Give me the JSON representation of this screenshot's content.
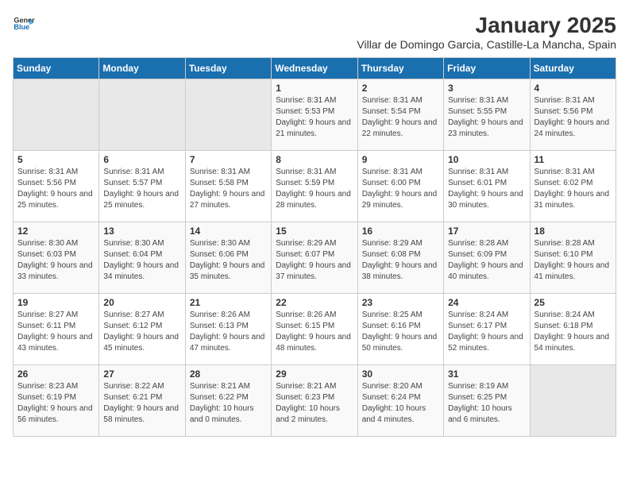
{
  "header": {
    "logo_line1": "General",
    "logo_line2": "Blue",
    "title": "January 2025",
    "subtitle": "Villar de Domingo Garcia, Castille-La Mancha, Spain"
  },
  "weekdays": [
    "Sunday",
    "Monday",
    "Tuesday",
    "Wednesday",
    "Thursday",
    "Friday",
    "Saturday"
  ],
  "weeks": [
    [
      {
        "day": "",
        "empty": true
      },
      {
        "day": "",
        "empty": true
      },
      {
        "day": "",
        "empty": true
      },
      {
        "day": "1",
        "sunrise": "Sunrise: 8:31 AM",
        "sunset": "Sunset: 5:53 PM",
        "daylight": "Daylight: 9 hours and 21 minutes."
      },
      {
        "day": "2",
        "sunrise": "Sunrise: 8:31 AM",
        "sunset": "Sunset: 5:54 PM",
        "daylight": "Daylight: 9 hours and 22 minutes."
      },
      {
        "day": "3",
        "sunrise": "Sunrise: 8:31 AM",
        "sunset": "Sunset: 5:55 PM",
        "daylight": "Daylight: 9 hours and 23 minutes."
      },
      {
        "day": "4",
        "sunrise": "Sunrise: 8:31 AM",
        "sunset": "Sunset: 5:56 PM",
        "daylight": "Daylight: 9 hours and 24 minutes."
      }
    ],
    [
      {
        "day": "5",
        "sunrise": "Sunrise: 8:31 AM",
        "sunset": "Sunset: 5:56 PM",
        "daylight": "Daylight: 9 hours and 25 minutes."
      },
      {
        "day": "6",
        "sunrise": "Sunrise: 8:31 AM",
        "sunset": "Sunset: 5:57 PM",
        "daylight": "Daylight: 9 hours and 25 minutes."
      },
      {
        "day": "7",
        "sunrise": "Sunrise: 8:31 AM",
        "sunset": "Sunset: 5:58 PM",
        "daylight": "Daylight: 9 hours and 27 minutes."
      },
      {
        "day": "8",
        "sunrise": "Sunrise: 8:31 AM",
        "sunset": "Sunset: 5:59 PM",
        "daylight": "Daylight: 9 hours and 28 minutes."
      },
      {
        "day": "9",
        "sunrise": "Sunrise: 8:31 AM",
        "sunset": "Sunset: 6:00 PM",
        "daylight": "Daylight: 9 hours and 29 minutes."
      },
      {
        "day": "10",
        "sunrise": "Sunrise: 8:31 AM",
        "sunset": "Sunset: 6:01 PM",
        "daylight": "Daylight: 9 hours and 30 minutes."
      },
      {
        "day": "11",
        "sunrise": "Sunrise: 8:31 AM",
        "sunset": "Sunset: 6:02 PM",
        "daylight": "Daylight: 9 hours and 31 minutes."
      }
    ],
    [
      {
        "day": "12",
        "sunrise": "Sunrise: 8:30 AM",
        "sunset": "Sunset: 6:03 PM",
        "daylight": "Daylight: 9 hours and 33 minutes."
      },
      {
        "day": "13",
        "sunrise": "Sunrise: 8:30 AM",
        "sunset": "Sunset: 6:04 PM",
        "daylight": "Daylight: 9 hours and 34 minutes."
      },
      {
        "day": "14",
        "sunrise": "Sunrise: 8:30 AM",
        "sunset": "Sunset: 6:06 PM",
        "daylight": "Daylight: 9 hours and 35 minutes."
      },
      {
        "day": "15",
        "sunrise": "Sunrise: 8:29 AM",
        "sunset": "Sunset: 6:07 PM",
        "daylight": "Daylight: 9 hours and 37 minutes."
      },
      {
        "day": "16",
        "sunrise": "Sunrise: 8:29 AM",
        "sunset": "Sunset: 6:08 PM",
        "daylight": "Daylight: 9 hours and 38 minutes."
      },
      {
        "day": "17",
        "sunrise": "Sunrise: 8:28 AM",
        "sunset": "Sunset: 6:09 PM",
        "daylight": "Daylight: 9 hours and 40 minutes."
      },
      {
        "day": "18",
        "sunrise": "Sunrise: 8:28 AM",
        "sunset": "Sunset: 6:10 PM",
        "daylight": "Daylight: 9 hours and 41 minutes."
      }
    ],
    [
      {
        "day": "19",
        "sunrise": "Sunrise: 8:27 AM",
        "sunset": "Sunset: 6:11 PM",
        "daylight": "Daylight: 9 hours and 43 minutes."
      },
      {
        "day": "20",
        "sunrise": "Sunrise: 8:27 AM",
        "sunset": "Sunset: 6:12 PM",
        "daylight": "Daylight: 9 hours and 45 minutes."
      },
      {
        "day": "21",
        "sunrise": "Sunrise: 8:26 AM",
        "sunset": "Sunset: 6:13 PM",
        "daylight": "Daylight: 9 hours and 47 minutes."
      },
      {
        "day": "22",
        "sunrise": "Sunrise: 8:26 AM",
        "sunset": "Sunset: 6:15 PM",
        "daylight": "Daylight: 9 hours and 48 minutes."
      },
      {
        "day": "23",
        "sunrise": "Sunrise: 8:25 AM",
        "sunset": "Sunset: 6:16 PM",
        "daylight": "Daylight: 9 hours and 50 minutes."
      },
      {
        "day": "24",
        "sunrise": "Sunrise: 8:24 AM",
        "sunset": "Sunset: 6:17 PM",
        "daylight": "Daylight: 9 hours and 52 minutes."
      },
      {
        "day": "25",
        "sunrise": "Sunrise: 8:24 AM",
        "sunset": "Sunset: 6:18 PM",
        "daylight": "Daylight: 9 hours and 54 minutes."
      }
    ],
    [
      {
        "day": "26",
        "sunrise": "Sunrise: 8:23 AM",
        "sunset": "Sunset: 6:19 PM",
        "daylight": "Daylight: 9 hours and 56 minutes."
      },
      {
        "day": "27",
        "sunrise": "Sunrise: 8:22 AM",
        "sunset": "Sunset: 6:21 PM",
        "daylight": "Daylight: 9 hours and 58 minutes."
      },
      {
        "day": "28",
        "sunrise": "Sunrise: 8:21 AM",
        "sunset": "Sunset: 6:22 PM",
        "daylight": "Daylight: 10 hours and 0 minutes."
      },
      {
        "day": "29",
        "sunrise": "Sunrise: 8:21 AM",
        "sunset": "Sunset: 6:23 PM",
        "daylight": "Daylight: 10 hours and 2 minutes."
      },
      {
        "day": "30",
        "sunrise": "Sunrise: 8:20 AM",
        "sunset": "Sunset: 6:24 PM",
        "daylight": "Daylight: 10 hours and 4 minutes."
      },
      {
        "day": "31",
        "sunrise": "Sunrise: 8:19 AM",
        "sunset": "Sunset: 6:25 PM",
        "daylight": "Daylight: 10 hours and 6 minutes."
      },
      {
        "day": "",
        "empty": true
      }
    ]
  ]
}
